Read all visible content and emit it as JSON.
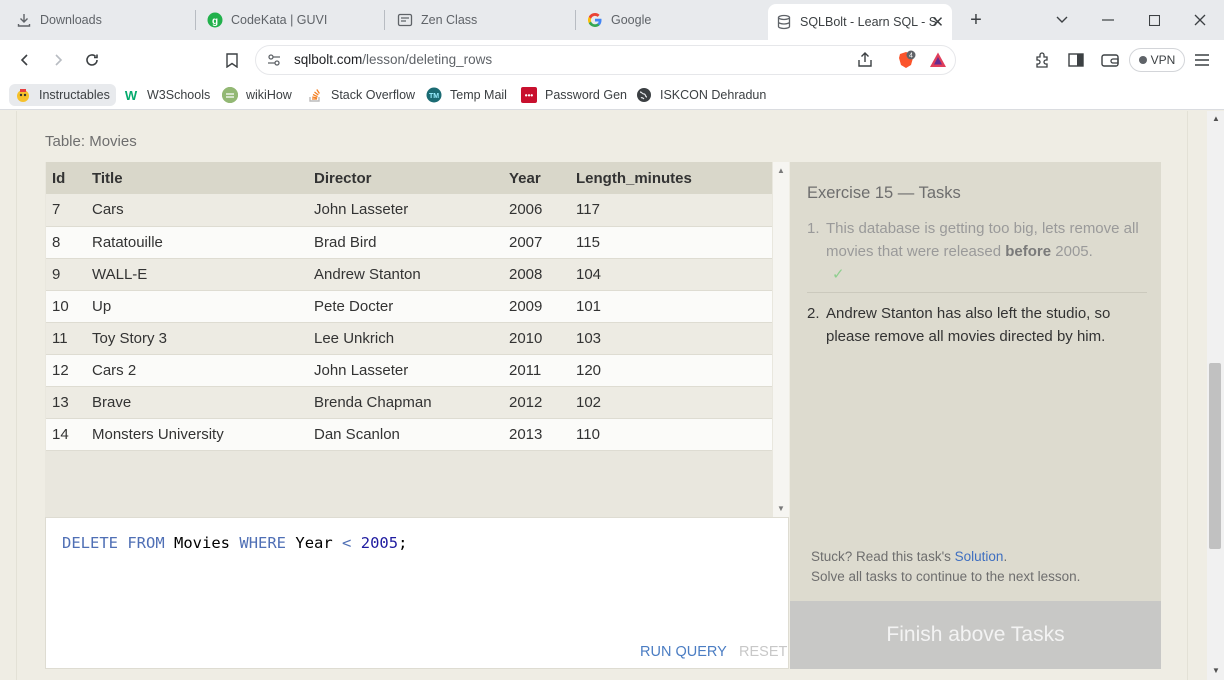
{
  "browser": {
    "tabs": [
      {
        "label": "Downloads",
        "icon": "download-icon"
      },
      {
        "label": "CodeKata | GUVI",
        "icon": "guvi-icon"
      },
      {
        "label": "Zen Class",
        "icon": "zen-icon"
      },
      {
        "label": "Google",
        "icon": "google-icon"
      },
      {
        "label": "SQLBolt - Learn SQL - S",
        "icon": "sqlbolt-icon",
        "active": true
      }
    ],
    "new_tab": "+",
    "url_host": "sqlbolt.com",
    "url_path": "/lesson/deleting_rows",
    "brave_badge": "4",
    "vpn_label": "VPN",
    "bookmarks": [
      {
        "label": "Instructables",
        "color": "#f6c12c"
      },
      {
        "label": "W3Schools",
        "color": "#04aa6d"
      },
      {
        "label": "wikiHow",
        "color": "#93b874"
      },
      {
        "label": "Stack Overflow",
        "color": "#f48024"
      },
      {
        "label": "Temp Mail",
        "color": "#1b6b73"
      },
      {
        "label": "Password Gen",
        "color": "#c8102e"
      },
      {
        "label": "ISKCON Dehradun",
        "color": "#3c4043"
      }
    ]
  },
  "lesson": {
    "table_label": "Table: Movies",
    "columns": [
      "Id",
      "Title",
      "Director",
      "Year",
      "Length_minutes"
    ],
    "rows": [
      [
        "7",
        "Cars",
        "John Lasseter",
        "2006",
        "117"
      ],
      [
        "8",
        "Ratatouille",
        "Brad Bird",
        "2007",
        "115"
      ],
      [
        "9",
        "WALL-E",
        "Andrew Stanton",
        "2008",
        "104"
      ],
      [
        "10",
        "Up",
        "Pete Docter",
        "2009",
        "101"
      ],
      [
        "11",
        "Toy Story 3",
        "Lee Unkrich",
        "2010",
        "103"
      ],
      [
        "12",
        "Cars 2",
        "John Lasseter",
        "2011",
        "120"
      ],
      [
        "13",
        "Brave",
        "Brenda Chapman",
        "2012",
        "102"
      ],
      [
        "14",
        "Monsters University",
        "Dan Scanlon",
        "2013",
        "110"
      ]
    ],
    "query": {
      "kw_delete": "DELETE",
      "kw_from": "FROM",
      "table": "Movies",
      "kw_where": "WHERE",
      "column": "Year",
      "op": "<",
      "value": "2005",
      "end": ";"
    },
    "run_label": "RUN QUERY",
    "reset_label": "RESET",
    "tasks_title": "Exercise 15 — Tasks",
    "task1": {
      "num": "1.",
      "text_before": "This database is getting too big, lets remove all movies that were released ",
      "bold": "before",
      "text_after": " 2005.",
      "check": "✓"
    },
    "task2": {
      "num": "2.",
      "text": "Andrew Stanton has also left the studio, so please remove all movies directed by him."
    },
    "stuck_text": "Stuck? Read this task's ",
    "solution_link": "Solution",
    "stuck_end": ".",
    "continue_text": "Solve all tasks to continue to the next lesson.",
    "finish_label": "Finish above Tasks"
  }
}
